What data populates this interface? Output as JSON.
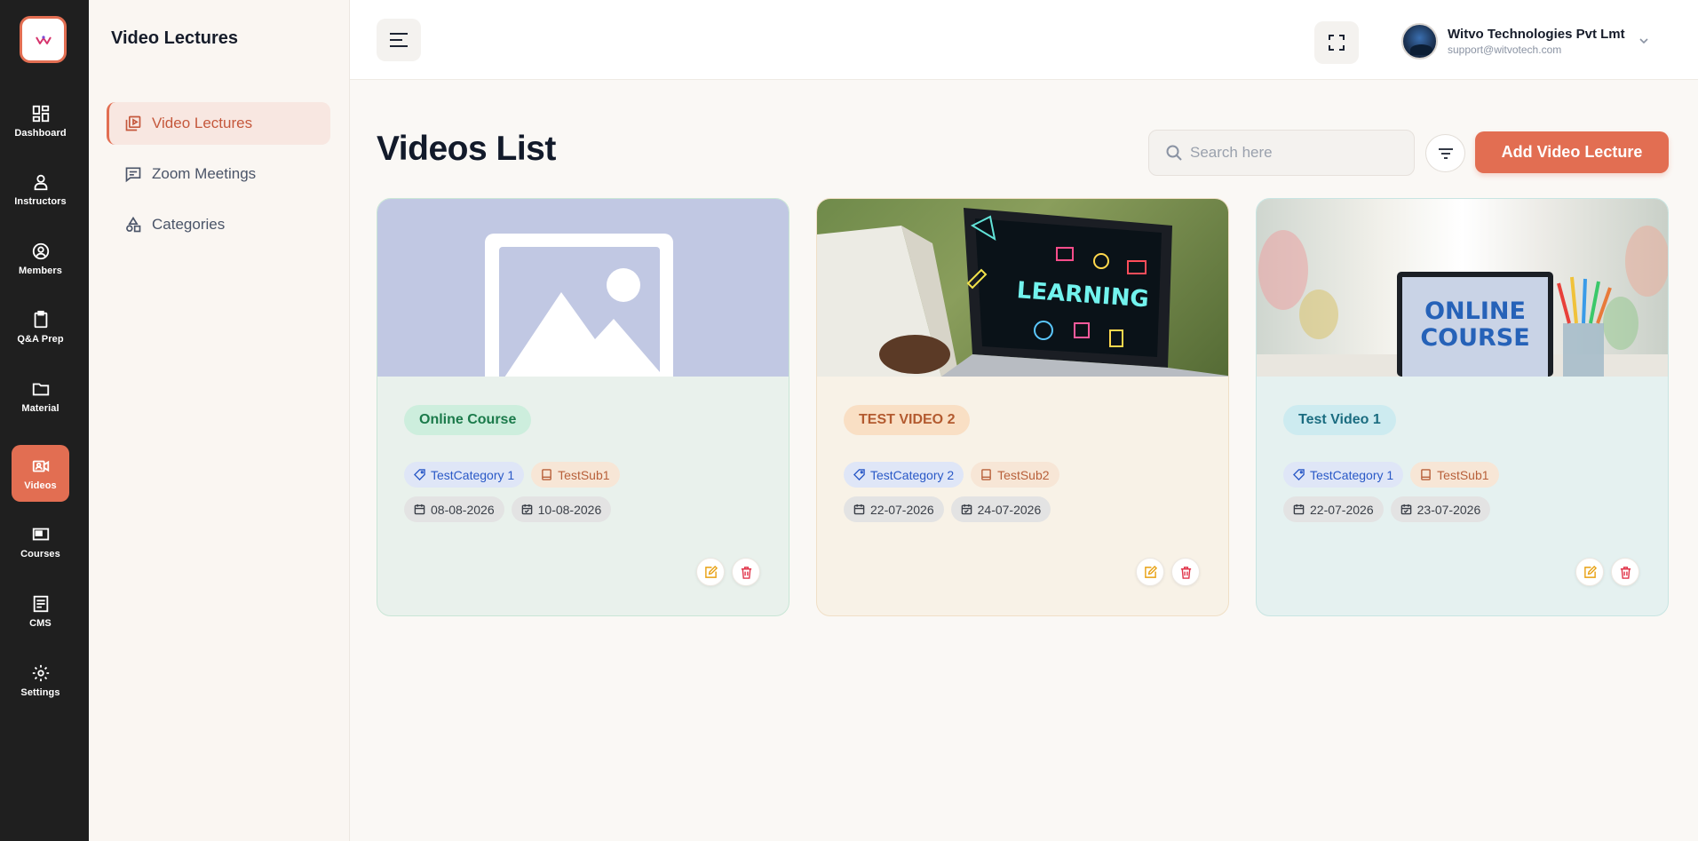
{
  "rail": {
    "items": [
      {
        "label": "Dashboard",
        "icon": "dashboard-icon"
      },
      {
        "label": "Instructors",
        "icon": "user-icon"
      },
      {
        "label": "Members",
        "icon": "user-circle-icon"
      },
      {
        "label": "Q&A Prep",
        "icon": "clipboard-icon"
      },
      {
        "label": "Material",
        "icon": "folder-icon"
      },
      {
        "label": "Videos",
        "icon": "video-icon"
      },
      {
        "label": "Courses",
        "icon": "monitor-icon"
      },
      {
        "label": "CMS",
        "icon": "document-icon"
      },
      {
        "label": "Settings",
        "icon": "gear-icon"
      }
    ],
    "active": "Videos",
    "accent": "#e26e52"
  },
  "subnav": {
    "title": "Video Lectures",
    "items": [
      {
        "label": "Video Lectures",
        "icon": "video-library-icon"
      },
      {
        "label": "Zoom Meetings",
        "icon": "chat-icon"
      },
      {
        "label": "Categories",
        "icon": "categories-icon"
      }
    ]
  },
  "header": {
    "user_name": "Witvo Technologies Pvt Lmt",
    "user_email": "support@witvotech.com"
  },
  "main": {
    "title": "Videos List",
    "search_placeholder": "Search here",
    "add_button": "Add Video Lecture",
    "cards": [
      {
        "title": "Online Course",
        "category": "TestCategory 1",
        "subcategory": "TestSub1",
        "start_date": "08-08-2026",
        "end_date": "10-08-2026"
      },
      {
        "title": "TEST VIDEO 2",
        "category": "TestCategory 2",
        "subcategory": "TestSub2",
        "start_date": "22-07-2026",
        "end_date": "24-07-2026"
      },
      {
        "title": "Test Video 1",
        "category": "TestCategory 1",
        "subcategory": "TestSub1",
        "start_date": "22-07-2026",
        "end_date": "23-07-2026"
      }
    ]
  },
  "thumb_texts": {
    "card2": "LEARNING",
    "card3_line1": "ONLINE",
    "card3_line2": "COURSE"
  }
}
